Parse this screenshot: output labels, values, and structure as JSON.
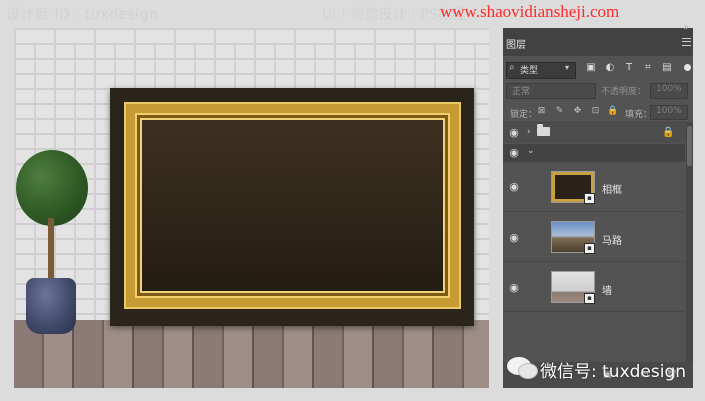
{
  "watermark": {
    "top_left": "设计庶 ID：tuxdesign",
    "top_center": "UI｜视觉设计｜PS教程",
    "top_right": "www.shaovidiansheji.com",
    "bottom": "微信号: tuxdesign"
  },
  "panel": {
    "tab_label": "图层",
    "filter": {
      "kind_label": "类型",
      "icons": [
        "image-filter-icon",
        "adjustment-filter-icon",
        "type-filter-icon",
        "shape-filter-icon",
        "smart-object-filter-icon"
      ]
    },
    "blend_mode": "正常",
    "opacity_label": "不透明度：",
    "opacity_value": "100%",
    "lock_label": "锁定：",
    "fill_label": "填充：",
    "fill_value": "100%",
    "layers": [
      {
        "name": "相框",
        "thumb": "frame",
        "visible": true
      },
      {
        "name": "马路",
        "thumb": "road",
        "visible": true
      },
      {
        "name": "墙",
        "thumb": "wall",
        "visible": true
      }
    ]
  },
  "colors": {
    "panel_bg": "#535353",
    "watermark_red": "#ff2a2a",
    "frame_gold": "#c69b34"
  }
}
